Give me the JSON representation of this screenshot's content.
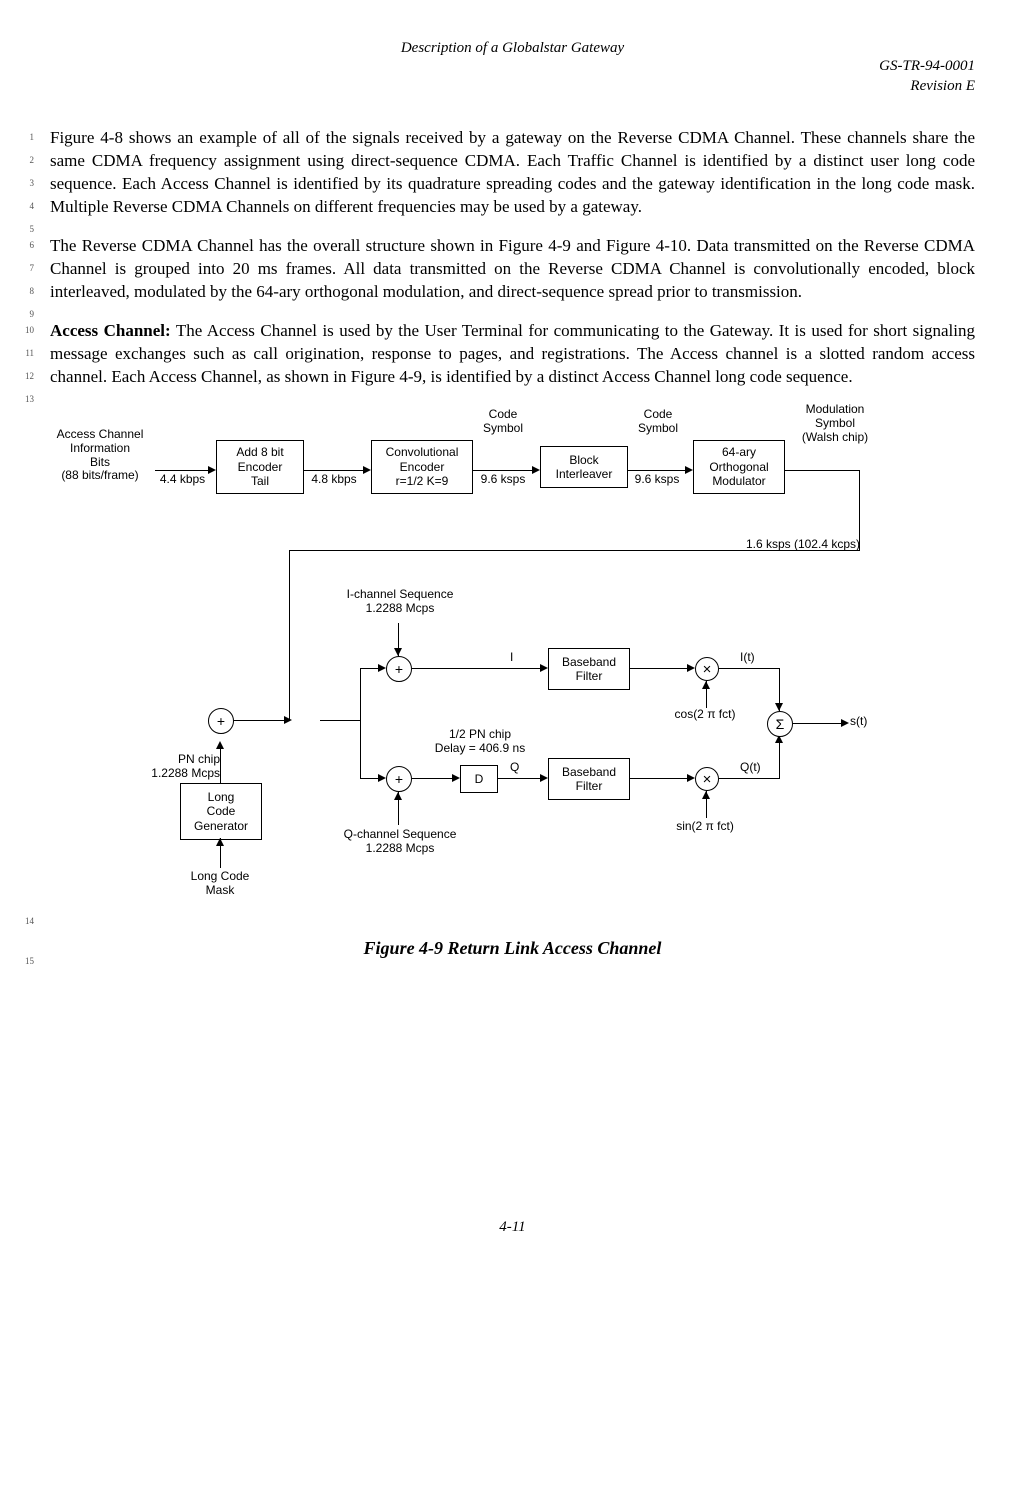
{
  "header": {
    "title": "Description of a Globalstar Gateway",
    "docnum": "GS-TR-94-0001",
    "revision": "Revision E"
  },
  "para1": {
    "lines": [
      "1",
      "2",
      "3",
      "4",
      "5"
    ],
    "text": "Figure 4-8 shows an example of all of the signals received by a gateway on the Reverse CDMA Channel.  These channels share the same CDMA frequency assignment using direct-sequence CDMA. Each Traffic Channel is identified by a distinct user long code sequence.  Each Access Channel is identified by its quadrature spreading codes and the gateway identification in the long code mask. Multiple Reverse CDMA Channels on different frequencies may be used by a gateway."
  },
  "para2": {
    "lines": [
      "6",
      "7",
      "8",
      "9"
    ],
    "text": "The Reverse CDMA Channel has the overall structure shown in  Figure 4-9 and Figure 4-10.  Data transmitted on the Reverse CDMA Channel is grouped into 20 ms frames. All data transmitted on the Reverse CDMA Channel is convolutionally encoded, block interleaved, modulated by the 64-ary orthogonal modulation, and direct-sequence spread prior to transmission."
  },
  "para3": {
    "lines": [
      "10",
      "11",
      "12",
      "13"
    ],
    "leadin": "Access Channel:",
    "text": "  The Access Channel is used by the User Terminal for communicating to the Gateway.  It is used for short signaling message exchanges such as call origination, response to pages, and registrations.  The Access channel is a slotted random access channel.  Each Access Channel, as shown in Figure 4-9, is identified by a distinct Access Channel long code sequence."
  },
  "diagram": {
    "source_label": "Access Channel\nInformation\nBits\n(88 bits/frame)",
    "rate1": "4.4 kbps",
    "box1": "Add 8 bit\nEncoder\nTail",
    "rate2": "4.8 kbps",
    "box2": "Convolutional\nEncoder\nr=1/2 K=9",
    "cs_label": "Code\nSymbol",
    "rate3": "9.6 ksps",
    "box3": "Block\nInterleaver",
    "rate4": "9.6 ksps",
    "box4": "64-ary\nOrthogonal\nModulator",
    "mod_label": "Modulation\nSymbol\n(Walsh chip)",
    "mod_rate": "1.6 ksps (102.4 kcps)",
    "ichan": "I-channel Sequence\n1.2288 Mcps",
    "qchan": "Q-channel Sequence\n1.2288 Mcps",
    "pn": "PN chip\n1.2288 Mcps",
    "longcode": "Long\nCode\nGenerator",
    "longmask": "Long Code\nMask",
    "delay_label": "1/2 PN chip\nDelay = 406.9 ns",
    "delay_box": "D",
    "bbf": "Baseband\nFilter",
    "i_lab": "I",
    "q_lab": "Q",
    "it": "I(t)",
    "qt": "Q(t)",
    "cos": "cos(2 π fct)",
    "sin": "sin(2 π fct)",
    "st": "s(t)",
    "sigma": "Σ"
  },
  "caption": {
    "ln": "15",
    "text": "Figure 4-9 Return Link Access Channel",
    "fig_ln": "14"
  },
  "page": "4-11"
}
